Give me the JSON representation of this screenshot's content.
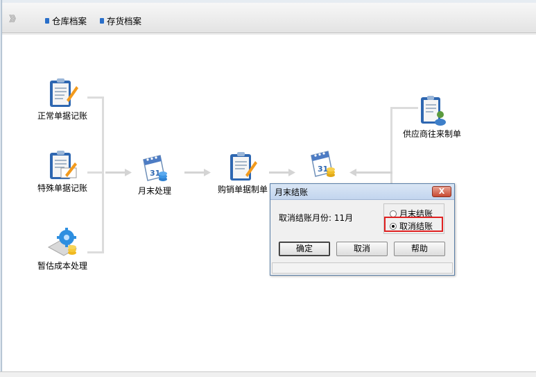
{
  "toolbar": {
    "chevron": "》》",
    "items": [
      {
        "label": "仓库档案",
        "icon": "folder-bullet-icon"
      },
      {
        "label": "存货档案",
        "icon": "folder-bullet-icon"
      }
    ]
  },
  "flow": {
    "nodes": [
      {
        "label": "正常单据记账",
        "icon": "clipboard-document-icon"
      },
      {
        "label": "特殊单据记账",
        "icon": "clipboard-document-icon"
      },
      {
        "label": "暂估成本处理",
        "icon": "gear-coins-icon"
      },
      {
        "label": "月末处理",
        "icon": "calendar-coins-icon"
      },
      {
        "label": "购销单据制单",
        "icon": "clipboard-pen-icon"
      },
      {
        "label": "",
        "icon": "calendar-coins-icon"
      },
      {
        "label": "供应商往来制单",
        "icon": "clipboard-user-icon"
      }
    ]
  },
  "dialog": {
    "title": "月末结账",
    "close_label": "X",
    "prompt": "取消结账月份:  11月",
    "options": [
      {
        "label": "月末结账",
        "checked": false
      },
      {
        "label": "取消结账",
        "checked": true
      }
    ],
    "buttons": {
      "ok": "确定",
      "cancel": "取消",
      "help": "帮助"
    }
  },
  "colors": {
    "accent": "#2a6fc9",
    "highlight": "#e02020",
    "connector": "#dcdcdc"
  }
}
